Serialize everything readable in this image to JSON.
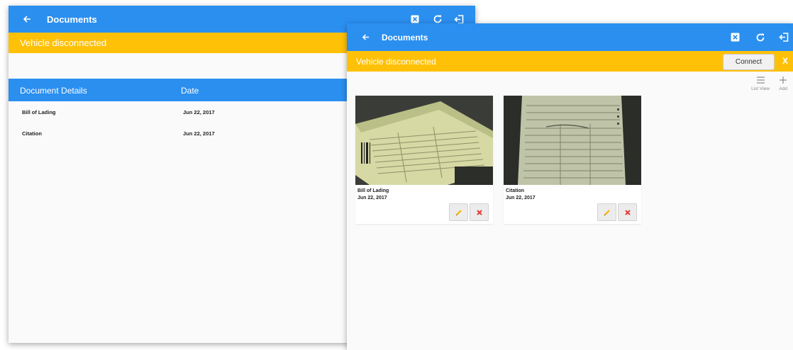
{
  "colors": {
    "appbar": "#2b8ff0",
    "banner": "#ffc107",
    "delete": "#e53935",
    "edit": "#f5b400"
  },
  "back_screen": {
    "appbar": {
      "title": "Documents",
      "icons": [
        "arrow-left-icon",
        "close-box-icon",
        "refresh-icon",
        "logout-icon"
      ]
    },
    "banner": {
      "text": "Vehicle disconnected"
    },
    "table": {
      "headers": [
        "Document Details",
        "Date"
      ],
      "rows": [
        {
          "name": "Bill of Lading",
          "date": "Jun 22, 2017"
        },
        {
          "name": "Citation",
          "date": "Jun 22, 2017"
        }
      ]
    }
  },
  "front_screen": {
    "appbar": {
      "title": "Documents",
      "icons": [
        "arrow-left-icon",
        "close-box-icon",
        "refresh-icon",
        "logout-icon"
      ]
    },
    "banner": {
      "text": "Vehicle disconnected",
      "connect_label": "Connect",
      "close_label": "X"
    },
    "toolbar": {
      "list_view_label": "List View",
      "add_label": "Add"
    },
    "cards": [
      {
        "name": "Bill of Lading",
        "date": "Jun 22, 2017",
        "image": "document-photo-bill-of-lading"
      },
      {
        "name": "Citation",
        "date": "Jun 22, 2017",
        "image": "document-photo-citation"
      }
    ]
  }
}
